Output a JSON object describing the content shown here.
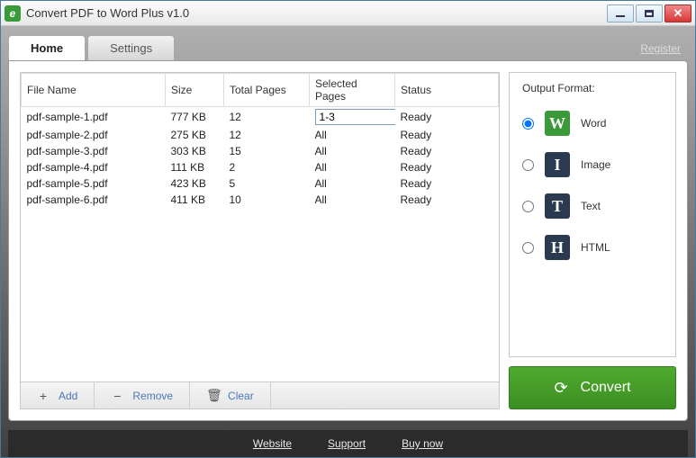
{
  "window": {
    "title": "Convert PDF to Word Plus v1.0"
  },
  "tabs": {
    "home": "Home",
    "settings": "Settings"
  },
  "register_link": "Register",
  "table": {
    "headers": {
      "filename": "File Name",
      "size": "Size",
      "total_pages": "Total Pages",
      "selected_pages": "Selected Pages",
      "status": "Status"
    },
    "rows": [
      {
        "filename": "pdf-sample-1.pdf",
        "size": "777 KB",
        "total_pages": "12",
        "selected_pages": "1-3",
        "status": "Ready",
        "editing": true
      },
      {
        "filename": "pdf-sample-2.pdf",
        "size": "275 KB",
        "total_pages": "12",
        "selected_pages": "All",
        "status": "Ready",
        "editing": false
      },
      {
        "filename": "pdf-sample-3.pdf",
        "size": "303 KB",
        "total_pages": "15",
        "selected_pages": "All",
        "status": "Ready",
        "editing": false
      },
      {
        "filename": "pdf-sample-4.pdf",
        "size": "111 KB",
        "total_pages": "2",
        "selected_pages": "All",
        "status": "Ready",
        "editing": false
      },
      {
        "filename": "pdf-sample-5.pdf",
        "size": "423 KB",
        "total_pages": "5",
        "selected_pages": "All",
        "status": "Ready",
        "editing": false
      },
      {
        "filename": "pdf-sample-6.pdf",
        "size": "411 KB",
        "total_pages": "10",
        "selected_pages": "All",
        "status": "Ready",
        "editing": false
      }
    ]
  },
  "toolbar": {
    "add": "Add",
    "remove": "Remove",
    "clear": "Clear"
  },
  "output": {
    "title": "Output Format:",
    "word": "Word",
    "image": "Image",
    "text": "Text",
    "html": "HTML",
    "selected": "word"
  },
  "convert_btn": "Convert",
  "footer": {
    "website": "Website",
    "support": "Support",
    "buy": "Buy now"
  }
}
